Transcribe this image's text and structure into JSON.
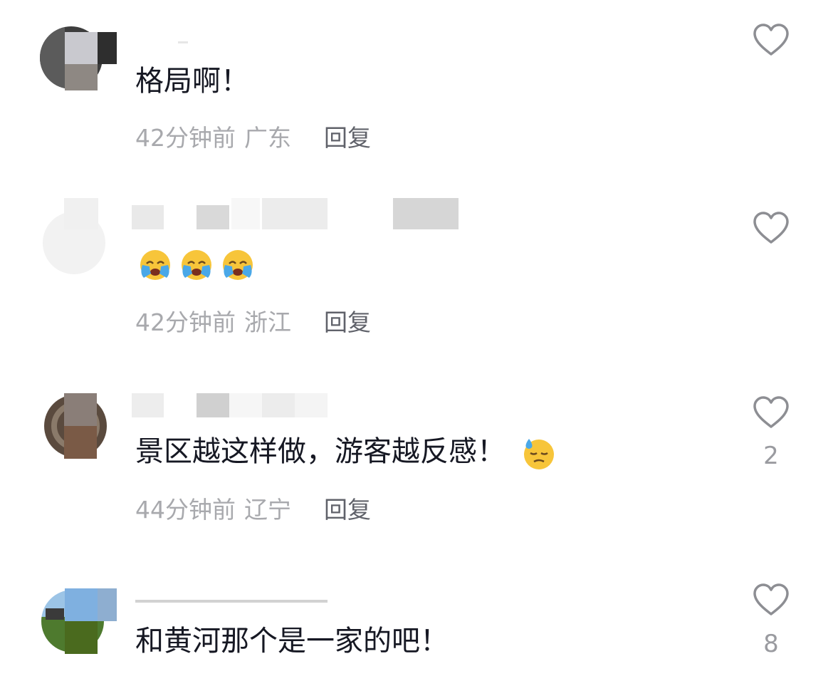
{
  "comments": [
    {
      "text": "格局啊！",
      "time": "42分钟前",
      "location": "广东",
      "reply_label": "回复",
      "like_count": ""
    },
    {
      "text": "",
      "emoji": [
        "loudly-crying-face",
        "loudly-crying-face",
        "loudly-crying-face"
      ],
      "time": "42分钟前",
      "location": "浙江",
      "reply_label": "回复",
      "like_count": ""
    },
    {
      "text": "景区越这样做，游客越反感！",
      "emoji_after": "downcast-face-with-sweat",
      "time": "44分钟前",
      "location": "辽宁",
      "reply_label": "回复",
      "like_count": "2"
    },
    {
      "text": "和黄河那个是一家的吧！",
      "like_count": "8"
    }
  ],
  "colors": {
    "text": "#161823",
    "meta": "#a8a9ad",
    "reply": "#60626a",
    "icon": "#8d8e93",
    "emoji_yellow": "#f7c53a",
    "emoji_tear": "#4aa8e8"
  }
}
